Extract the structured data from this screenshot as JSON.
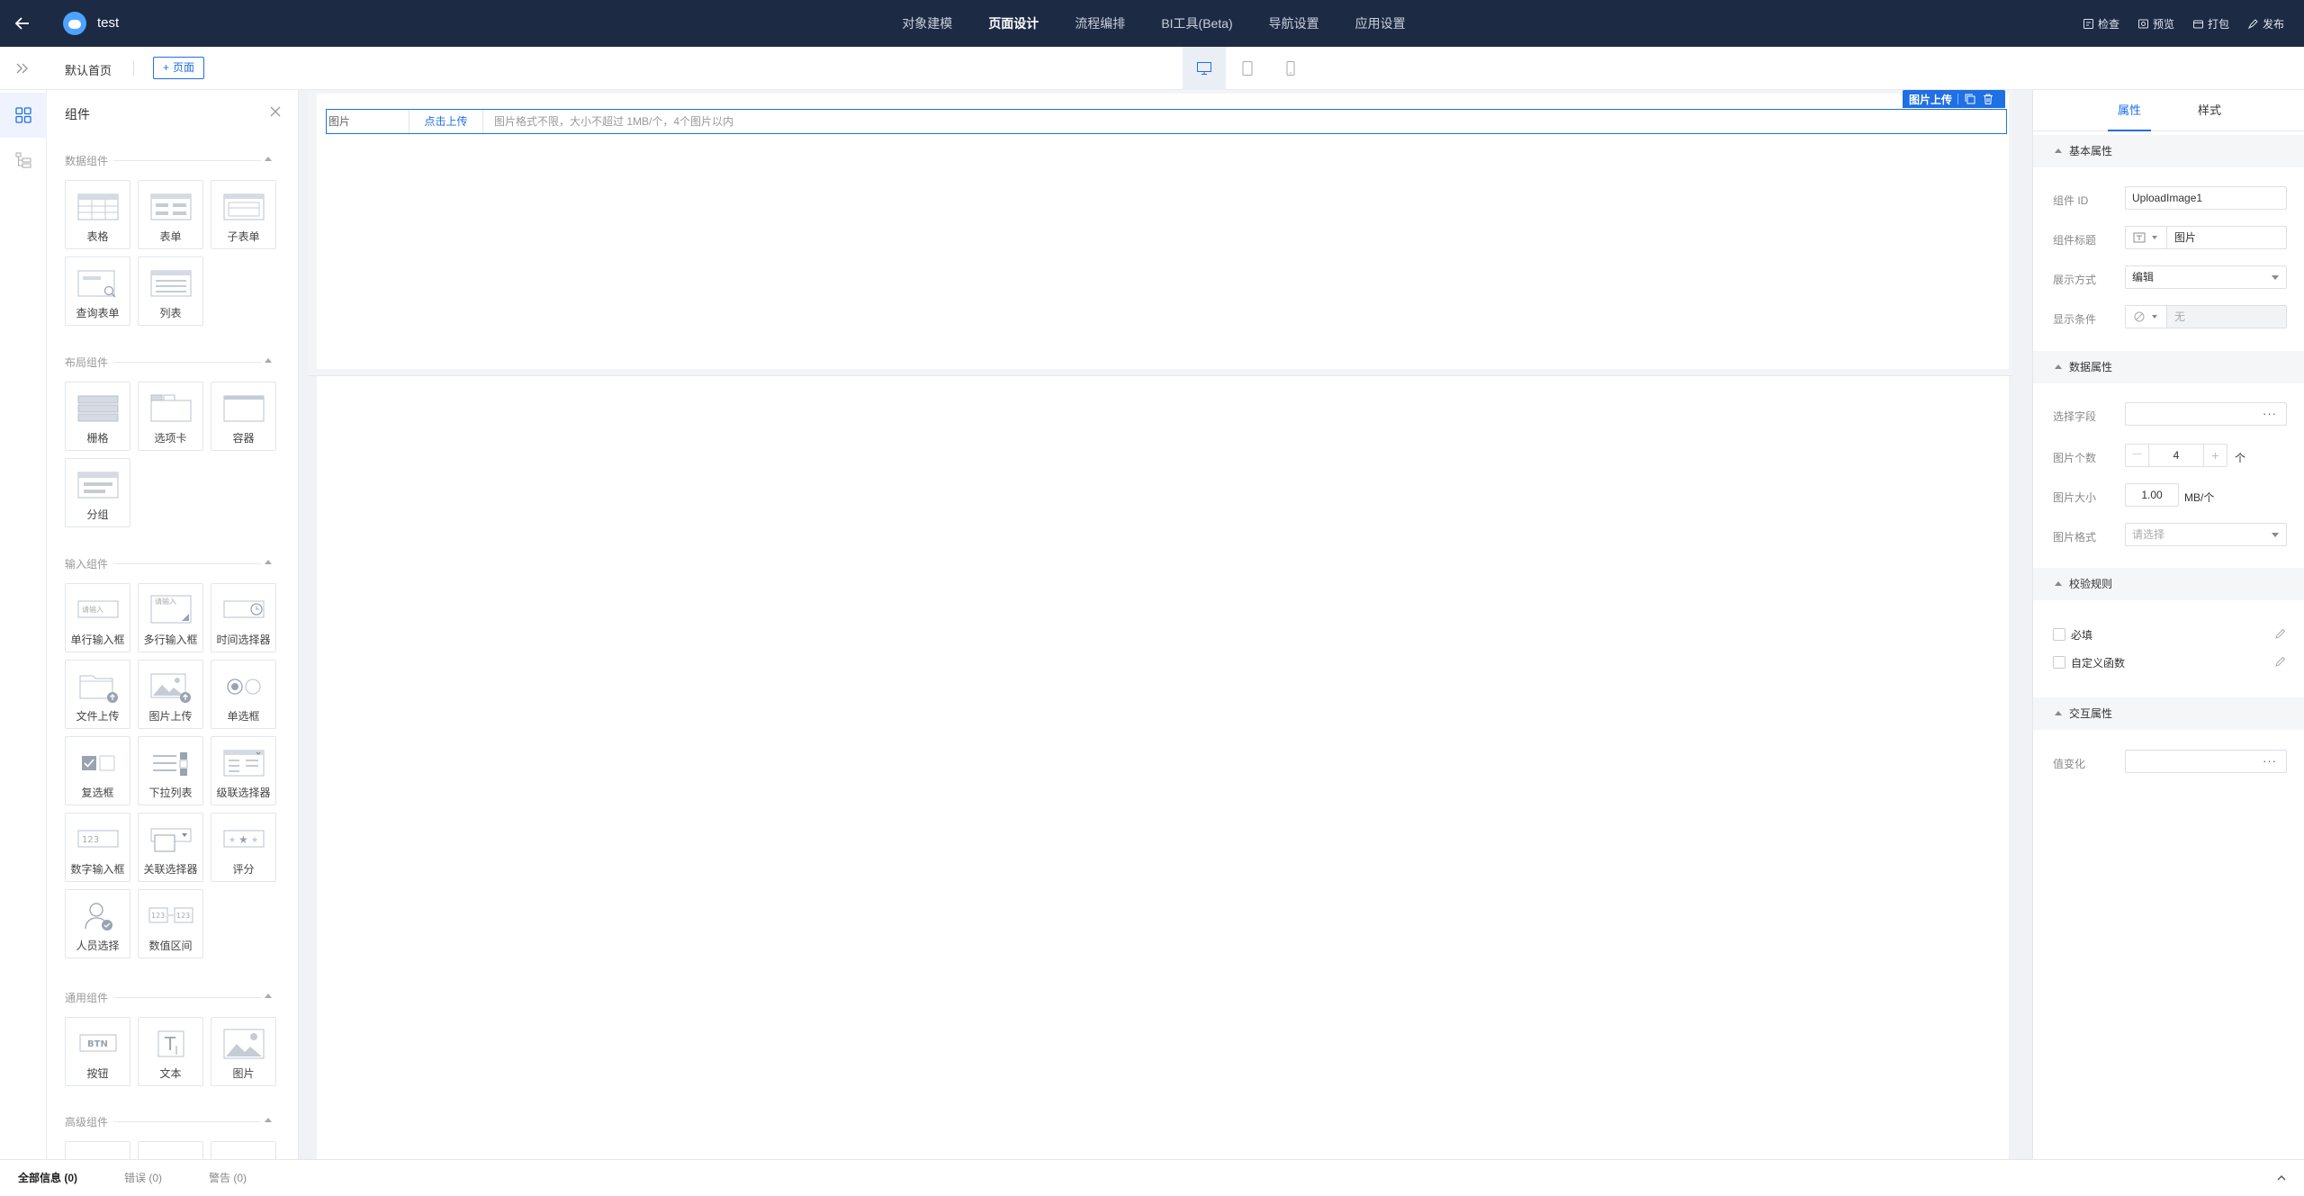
{
  "topbar": {
    "app_title": "test",
    "nav": [
      "对象建模",
      "页面设计",
      "流程编排",
      "BI工具(Beta)",
      "导航设置",
      "应用设置"
    ],
    "actions": [
      {
        "label": "检查",
        "icon": "check-doc-icon"
      },
      {
        "label": "预览",
        "icon": "preview-icon"
      },
      {
        "label": "打包",
        "icon": "package-icon"
      },
      {
        "label": "发布",
        "icon": "publish-icon"
      }
    ]
  },
  "subbar": {
    "page_name": "默认首页",
    "add_page_label": "页面",
    "devices": [
      "desktop-icon",
      "tablet-icon",
      "mobile-icon"
    ]
  },
  "components": {
    "title": "组件",
    "groups": [
      {
        "title": "数据组件",
        "items": [
          "表格",
          "表单",
          "子表单",
          "查询表单",
          "列表"
        ]
      },
      {
        "title": "布局组件",
        "items": [
          "栅格",
          "选项卡",
          "容器",
          "分组"
        ]
      },
      {
        "title": "输入组件",
        "items": [
          "单行输入框",
          "多行输入框",
          "时间选择器",
          "文件上传",
          "图片上传",
          "单选框",
          "复选框",
          "下拉列表",
          "级联选择器",
          "数字输入框",
          "关联选择器",
          "评分",
          "人员选择",
          "数值区间"
        ]
      },
      {
        "title": "通用组件",
        "items": [
          "按钮",
          "文本",
          "图片"
        ]
      },
      {
        "title": "高级组件",
        "items": []
      }
    ],
    "tile_hints": {
      "single_input": "请输入",
      "multi_input": "请输入",
      "number": "123",
      "range_a": "123",
      "range_b": "123",
      "btn": "BTN",
      "text": "T"
    }
  },
  "canvas": {
    "upload_label": "图片",
    "upload_button": "点击上传",
    "upload_tip": "图片格式不限，大小不超过 1MB/个，4个图片以内",
    "selected_component": "图片上传"
  },
  "properties": {
    "tabs": [
      "属性",
      "样式"
    ],
    "sections": {
      "basic": "基本属性",
      "data": "数据属性",
      "validation": "校验规则",
      "interaction": "交互属性"
    },
    "component_id_label": "组件 ID",
    "component_id": "UploadImage1",
    "title_label": "组件标题",
    "title_value": "图片",
    "display_label": "展示方式",
    "display_value": "编辑",
    "condition_label": "显示条件",
    "condition_value": "无",
    "field_label": "选择字段",
    "count_label": "图片个数",
    "count_value": "4",
    "count_unit": "个",
    "size_label": "图片大小",
    "size_value": "1.00",
    "size_unit": "MB/个",
    "format_label": "图片格式",
    "format_placeholder": "请选择",
    "required_label": "必填",
    "custom_fn_label": "自定义函数",
    "on_change_label": "值变化",
    "more": "···",
    "minus": "—",
    "plus": "+"
  },
  "statusbar": {
    "all": "全部信息 (0)",
    "errors": "错误 (0)",
    "warnings": "警告 (0)"
  },
  "colors": {
    "topbar": "#1d2a44",
    "accent": "#1f6fe5"
  }
}
